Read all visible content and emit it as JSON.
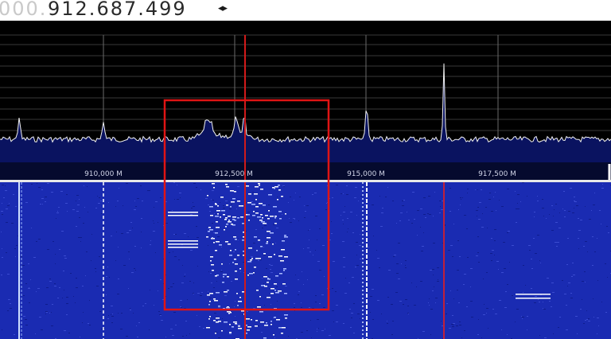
{
  "frequency": {
    "dimmed_prefix": "000.",
    "main": "912.687.499",
    "step_arrows": "◂▸"
  },
  "spectrum": {
    "freq_axis_labels": [
      "910,000 M",
      "912,500 M",
      "915,000 M",
      "917,500 M"
    ],
    "colors": {
      "background": "#000000",
      "fill": "#0a1360",
      "trace": "#f2f2f2",
      "grid": "#5a5a5a",
      "tuning_line": "#d11a1a",
      "selection_box": "#e01414"
    }
  },
  "waterfall": {
    "colors": {
      "background": "#1a2bb2",
      "signal": "#ffffff"
    }
  }
}
